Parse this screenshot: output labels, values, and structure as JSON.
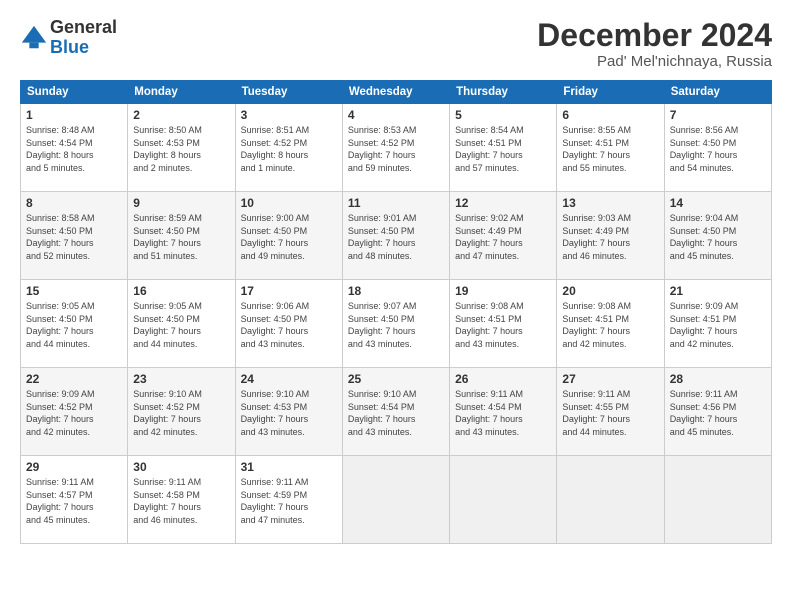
{
  "logo": {
    "general": "General",
    "blue": "Blue"
  },
  "title": {
    "main": "December 2024",
    "sub": "Pad' Mel'nichnaya, Russia"
  },
  "headers": [
    "Sunday",
    "Monday",
    "Tuesday",
    "Wednesday",
    "Thursday",
    "Friday",
    "Saturday"
  ],
  "weeks": [
    {
      "shaded": false,
      "days": [
        {
          "num": "1",
          "info": "Sunrise: 8:48 AM\nSunset: 4:54 PM\nDaylight: 8 hours\nand 5 minutes."
        },
        {
          "num": "2",
          "info": "Sunrise: 8:50 AM\nSunset: 4:53 PM\nDaylight: 8 hours\nand 2 minutes."
        },
        {
          "num": "3",
          "info": "Sunrise: 8:51 AM\nSunset: 4:52 PM\nDaylight: 8 hours\nand 1 minute."
        },
        {
          "num": "4",
          "info": "Sunrise: 8:53 AM\nSunset: 4:52 PM\nDaylight: 7 hours\nand 59 minutes."
        },
        {
          "num": "5",
          "info": "Sunrise: 8:54 AM\nSunset: 4:51 PM\nDaylight: 7 hours\nand 57 minutes."
        },
        {
          "num": "6",
          "info": "Sunrise: 8:55 AM\nSunset: 4:51 PM\nDaylight: 7 hours\nand 55 minutes."
        },
        {
          "num": "7",
          "info": "Sunrise: 8:56 AM\nSunset: 4:50 PM\nDaylight: 7 hours\nand 54 minutes."
        }
      ]
    },
    {
      "shaded": true,
      "days": [
        {
          "num": "8",
          "info": "Sunrise: 8:58 AM\nSunset: 4:50 PM\nDaylight: 7 hours\nand 52 minutes."
        },
        {
          "num": "9",
          "info": "Sunrise: 8:59 AM\nSunset: 4:50 PM\nDaylight: 7 hours\nand 51 minutes."
        },
        {
          "num": "10",
          "info": "Sunrise: 9:00 AM\nSunset: 4:50 PM\nDaylight: 7 hours\nand 49 minutes."
        },
        {
          "num": "11",
          "info": "Sunrise: 9:01 AM\nSunset: 4:50 PM\nDaylight: 7 hours\nand 48 minutes."
        },
        {
          "num": "12",
          "info": "Sunrise: 9:02 AM\nSunset: 4:49 PM\nDaylight: 7 hours\nand 47 minutes."
        },
        {
          "num": "13",
          "info": "Sunrise: 9:03 AM\nSunset: 4:49 PM\nDaylight: 7 hours\nand 46 minutes."
        },
        {
          "num": "14",
          "info": "Sunrise: 9:04 AM\nSunset: 4:50 PM\nDaylight: 7 hours\nand 45 minutes."
        }
      ]
    },
    {
      "shaded": false,
      "days": [
        {
          "num": "15",
          "info": "Sunrise: 9:05 AM\nSunset: 4:50 PM\nDaylight: 7 hours\nand 44 minutes."
        },
        {
          "num": "16",
          "info": "Sunrise: 9:05 AM\nSunset: 4:50 PM\nDaylight: 7 hours\nand 44 minutes."
        },
        {
          "num": "17",
          "info": "Sunrise: 9:06 AM\nSunset: 4:50 PM\nDaylight: 7 hours\nand 43 minutes."
        },
        {
          "num": "18",
          "info": "Sunrise: 9:07 AM\nSunset: 4:50 PM\nDaylight: 7 hours\nand 43 minutes."
        },
        {
          "num": "19",
          "info": "Sunrise: 9:08 AM\nSunset: 4:51 PM\nDaylight: 7 hours\nand 43 minutes."
        },
        {
          "num": "20",
          "info": "Sunrise: 9:08 AM\nSunset: 4:51 PM\nDaylight: 7 hours\nand 42 minutes."
        },
        {
          "num": "21",
          "info": "Sunrise: 9:09 AM\nSunset: 4:51 PM\nDaylight: 7 hours\nand 42 minutes."
        }
      ]
    },
    {
      "shaded": true,
      "days": [
        {
          "num": "22",
          "info": "Sunrise: 9:09 AM\nSunset: 4:52 PM\nDaylight: 7 hours\nand 42 minutes."
        },
        {
          "num": "23",
          "info": "Sunrise: 9:10 AM\nSunset: 4:52 PM\nDaylight: 7 hours\nand 42 minutes."
        },
        {
          "num": "24",
          "info": "Sunrise: 9:10 AM\nSunset: 4:53 PM\nDaylight: 7 hours\nand 43 minutes."
        },
        {
          "num": "25",
          "info": "Sunrise: 9:10 AM\nSunset: 4:54 PM\nDaylight: 7 hours\nand 43 minutes."
        },
        {
          "num": "26",
          "info": "Sunrise: 9:11 AM\nSunset: 4:54 PM\nDaylight: 7 hours\nand 43 minutes."
        },
        {
          "num": "27",
          "info": "Sunrise: 9:11 AM\nSunset: 4:55 PM\nDaylight: 7 hours\nand 44 minutes."
        },
        {
          "num": "28",
          "info": "Sunrise: 9:11 AM\nSunset: 4:56 PM\nDaylight: 7 hours\nand 45 minutes."
        }
      ]
    },
    {
      "shaded": false,
      "days": [
        {
          "num": "29",
          "info": "Sunrise: 9:11 AM\nSunset: 4:57 PM\nDaylight: 7 hours\nand 45 minutes."
        },
        {
          "num": "30",
          "info": "Sunrise: 9:11 AM\nSunset: 4:58 PM\nDaylight: 7 hours\nand 46 minutes."
        },
        {
          "num": "31",
          "info": "Sunrise: 9:11 AM\nSunset: 4:59 PM\nDaylight: 7 hours\nand 47 minutes."
        },
        {
          "num": "",
          "info": ""
        },
        {
          "num": "",
          "info": ""
        },
        {
          "num": "",
          "info": ""
        },
        {
          "num": "",
          "info": ""
        }
      ]
    }
  ]
}
